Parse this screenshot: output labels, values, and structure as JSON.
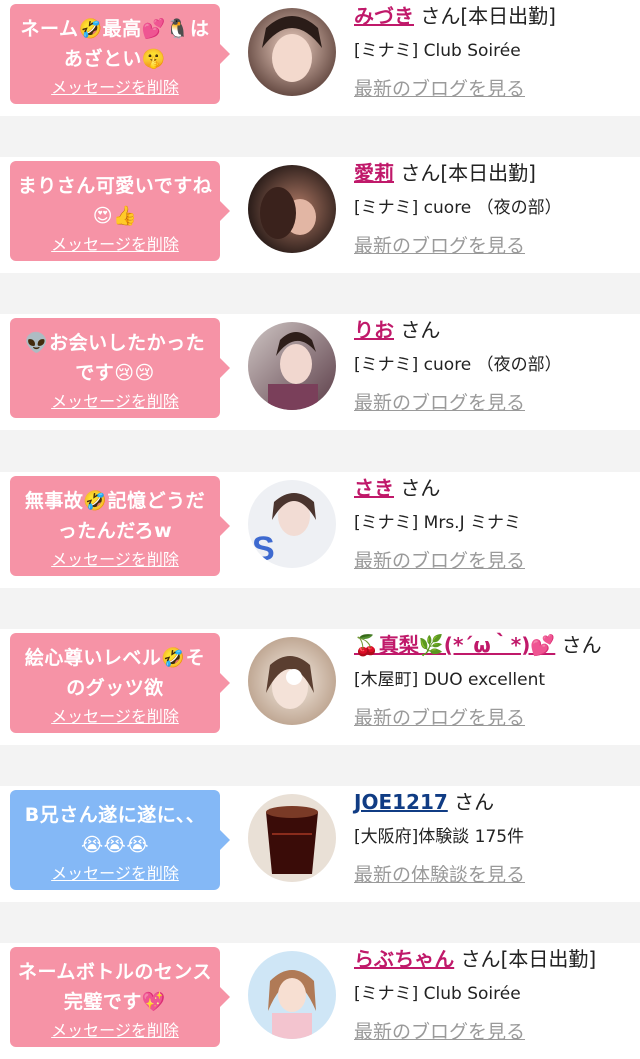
{
  "san_suffix": "さん",
  "delete_label": "メッセージを削除",
  "items": [
    {
      "message": "ネーム🤣最高💕🐧はあざとい🤫",
      "name": "みづき",
      "status": "[本日出勤]",
      "shop": "[ミナミ] Club Soirée",
      "link": "最新のブログを見る",
      "type": "girl",
      "avatar": "girl-avatar-1"
    },
    {
      "message": "まりさん可愛いですね😍👍",
      "name": "愛莉",
      "status": "[本日出勤]",
      "shop": "[ミナミ] cuore （夜の部）",
      "link": "最新のブログを見る",
      "type": "girl",
      "avatar": "girl-avatar-2"
    },
    {
      "message": "👽お会いしたかったです😢😢",
      "name": "りお",
      "status": "",
      "shop": "[ミナミ] cuore （夜の部）",
      "link": "最新のブログを見る",
      "type": "girl",
      "avatar": "girl-avatar-3"
    },
    {
      "message": "無事故🤣記憶どうだったんだろw",
      "name": "さき",
      "status": "",
      "shop": "[ミナミ] Mrs.J ミナミ",
      "link": "最新のブログを見る",
      "type": "girl",
      "avatar": "girl-avatar-4"
    },
    {
      "message": "絵心尊いレベル🤣そのグッツ欲",
      "name": "🍒真梨🌿(*´ω｀*)💕",
      "status": "",
      "shop": "[木屋町] DUO excellent",
      "link": "最新のブログを見る",
      "type": "girl",
      "avatar": "girl-avatar-5"
    },
    {
      "message": "B兄さん遂に遂に、、😭😭😭",
      "name": "JOE1217",
      "status": "",
      "shop": "[大阪府]体験談 175件",
      "link": "最新の体験談を見る",
      "type": "user",
      "avatar": "drink-glass-avatar"
    },
    {
      "message": "ネームボトルのセンス完璧です💖",
      "name": "らぶちゃん",
      "status": "[本日出勤]",
      "shop": "[ミナミ] Club Soirée",
      "link": "最新のブログを見る",
      "type": "girl",
      "avatar": "illustration-avatar"
    }
  ],
  "colors": {
    "pink_bubble": "#f693a6",
    "blue_bubble": "#84b8f6",
    "pink_name": "#c0196a",
    "blue_name": "#103c84"
  }
}
